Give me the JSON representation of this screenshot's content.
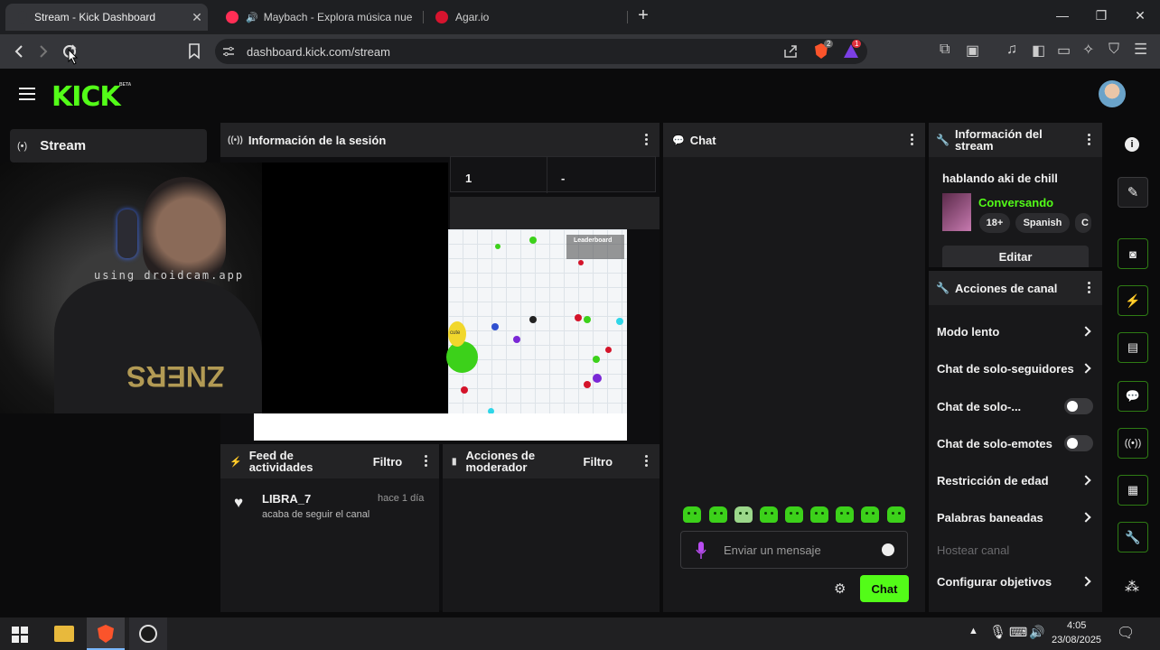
{
  "browser": {
    "tabs": [
      {
        "title": "Stream - Kick Dashboard",
        "active": true
      },
      {
        "title": "Maybach - Explora música nueva",
        "active": false
      },
      {
        "title": "Agar.io",
        "active": false
      }
    ],
    "url": "dashboard.kick.com/stream",
    "brave_badge": "2",
    "rewards_badge": "1"
  },
  "kick": {
    "logo": "KICK",
    "beta": "BETA",
    "sidebar": {
      "stream_label": "Stream"
    }
  },
  "session_panel": {
    "title": "Información de la sesión",
    "stat_values": [
      "1",
      "-"
    ]
  },
  "overlay": {
    "watermark": "using droidcam.app"
  },
  "game": {
    "leaderboard_title": "Leaderboard",
    "player_name": "cute"
  },
  "activity_feed": {
    "title": "Feed de actividades",
    "filter": "Filtro",
    "items": [
      {
        "user": "LIBRA_7",
        "time": "hace 1 día",
        "text": "acaba de seguir el canal"
      }
    ]
  },
  "moderator": {
    "title": "Acciones de moderador",
    "filter": "Filtro"
  },
  "chat": {
    "title": "Chat",
    "placeholder": "Enviar un mensaje",
    "send_label": "Chat"
  },
  "stream_info": {
    "title": "Información del stream",
    "stream_title": "hablando aki de chill",
    "category": "Conversando",
    "tags": [
      "18+",
      "Spanish",
      "C"
    ],
    "edit_label": "Editar"
  },
  "channel_actions": {
    "title": "Acciones de canal",
    "items": [
      {
        "label": "Modo lento",
        "control": "chevron"
      },
      {
        "label": "Chat de solo-seguidores",
        "control": "chevron"
      },
      {
        "label": "Chat de solo-...",
        "control": "toggle"
      },
      {
        "label": "Chat de solo-emotes",
        "control": "toggle"
      },
      {
        "label": "Restricción de edad",
        "control": "chevron"
      },
      {
        "label": "Palabras baneadas",
        "control": "chevron"
      },
      {
        "label": "Hostear canal",
        "control": "disabled"
      },
      {
        "label": "Configurar objetivos",
        "control": "chevron"
      }
    ]
  },
  "colors": {
    "accent": "#53fc18",
    "panel": "#18181a",
    "panel_header": "#232325"
  },
  "taskbar": {
    "time": "4:05",
    "date": "23/08/2025"
  }
}
